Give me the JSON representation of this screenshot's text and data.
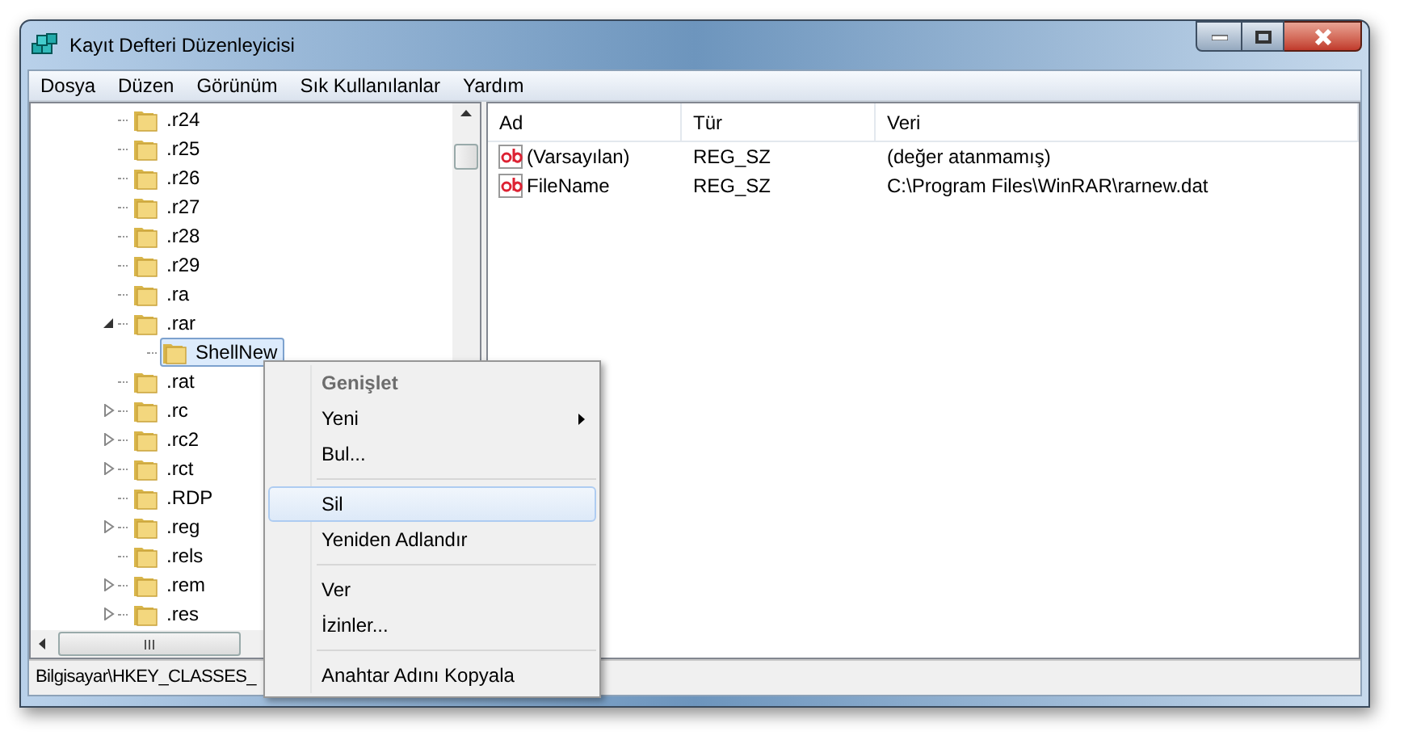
{
  "window": {
    "title": "Kayıt Defteri Düzenleyicisi"
  },
  "menu_bar": [
    "Dosya",
    "Düzen",
    "Görünüm",
    "Sık Kullanılanlar",
    "Yardım"
  ],
  "tree": [
    {
      "label": ".r24",
      "expandable": false,
      "selected": false
    },
    {
      "label": ".r25",
      "expandable": false,
      "selected": false
    },
    {
      "label": ".r26",
      "expandable": false,
      "selected": false
    },
    {
      "label": ".r27",
      "expandable": false,
      "selected": false
    },
    {
      "label": ".r28",
      "expandable": false,
      "selected": false
    },
    {
      "label": ".r29",
      "expandable": false,
      "selected": false
    },
    {
      "label": ".ra",
      "expandable": false,
      "selected": false
    },
    {
      "label": ".rar",
      "expandable": true,
      "expanded": true,
      "selected": false,
      "children": [
        {
          "label": "ShellNew",
          "expandable": false,
          "selected": true
        }
      ]
    },
    {
      "label": ".rat",
      "expandable": false,
      "selected": false
    },
    {
      "label": ".rc",
      "expandable": true,
      "expanded": false,
      "selected": false
    },
    {
      "label": ".rc2",
      "expandable": true,
      "expanded": false,
      "selected": false
    },
    {
      "label": ".rct",
      "expandable": true,
      "expanded": false,
      "selected": false
    },
    {
      "label": ".RDP",
      "expandable": false,
      "selected": false
    },
    {
      "label": ".reg",
      "expandable": true,
      "expanded": false,
      "selected": false
    },
    {
      "label": ".rels",
      "expandable": false,
      "selected": false
    },
    {
      "label": ".rem",
      "expandable": true,
      "expanded": false,
      "selected": false
    },
    {
      "label": ".res",
      "expandable": true,
      "expanded": false,
      "selected": false
    }
  ],
  "values_table": {
    "columns": [
      "Ad",
      "Tür",
      "Veri"
    ],
    "rows": [
      {
        "name": "(Varsayılan)",
        "type": "REG_SZ",
        "data": "(değer atanmamış)"
      },
      {
        "name": "FileName",
        "type": "REG_SZ",
        "data": "C:\\Program Files\\WinRAR\\rarnew.dat"
      }
    ]
  },
  "status_bar": "Bilgisayar\\HKEY_CLASSES_",
  "context_menu": [
    {
      "kind": "item",
      "label": "Genişlet",
      "bold": true,
      "disabled": true,
      "submenu": false,
      "selected": false
    },
    {
      "kind": "item",
      "label": "Yeni",
      "bold": false,
      "disabled": false,
      "submenu": true,
      "selected": false
    },
    {
      "kind": "item",
      "label": "Bul...",
      "bold": false,
      "disabled": false,
      "submenu": false,
      "selected": false
    },
    {
      "kind": "separator"
    },
    {
      "kind": "item",
      "label": "Sil",
      "bold": false,
      "disabled": false,
      "submenu": false,
      "selected": true
    },
    {
      "kind": "item",
      "label": "Yeniden Adlandır",
      "bold": false,
      "disabled": false,
      "submenu": false,
      "selected": false
    },
    {
      "kind": "separator"
    },
    {
      "kind": "item",
      "label": "Ver",
      "bold": false,
      "disabled": false,
      "submenu": false,
      "selected": false
    },
    {
      "kind": "item",
      "label": "İzinler...",
      "bold": false,
      "disabled": false,
      "submenu": false,
      "selected": false
    },
    {
      "kind": "separator"
    },
    {
      "kind": "item",
      "label": "Anahtar Adını Kopyala",
      "bold": false,
      "disabled": false,
      "submenu": false,
      "selected": false
    }
  ]
}
